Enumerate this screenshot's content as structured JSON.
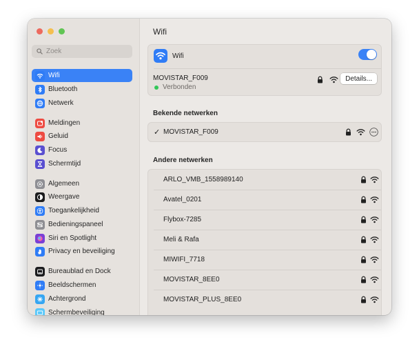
{
  "window": {
    "traffic_lights": [
      "close",
      "minimize",
      "maximize"
    ]
  },
  "sidebar": {
    "search_placeholder": "Zoek",
    "items": [
      {
        "label": "Wifi",
        "icon": "wifi-icon",
        "color": "#2f7cf6",
        "active": true
      },
      {
        "label": "Bluetooth",
        "icon": "bluetooth-icon",
        "color": "#2f7cf6"
      },
      {
        "label": "Netwerk",
        "icon": "globe-icon",
        "color": "#2f7cf6"
      },
      {
        "label": "Meldingen",
        "icon": "notifications-icon",
        "color": "#ee4b42"
      },
      {
        "label": "Geluid",
        "icon": "speaker-icon",
        "color": "#ee4b42"
      },
      {
        "label": "Focus",
        "icon": "moon-icon",
        "color": "#5a4fd0"
      },
      {
        "label": "Schermtijd",
        "icon": "hourglass-icon",
        "color": "#5a4fd0"
      },
      {
        "label": "Algemeen",
        "icon": "gear-icon",
        "color": "#8e8e93"
      },
      {
        "label": "Weergave",
        "icon": "appearance-icon",
        "color": "#1c1c1e"
      },
      {
        "label": "Toegankelijkheid",
        "icon": "accessibility-icon",
        "color": "#2f7cf6"
      },
      {
        "label": "Bedieningspaneel",
        "icon": "control-center-icon",
        "color": "#8e8e93"
      },
      {
        "label": "Siri en Spotlight",
        "icon": "siri-icon",
        "color": "#7a3fd6"
      },
      {
        "label": "Privacy en beveiliging",
        "icon": "hand-icon",
        "color": "#2f7cf6"
      },
      {
        "label": "Bureaublad en Dock",
        "icon": "dock-icon",
        "color": "#1c1c1e"
      },
      {
        "label": "Beeldschermen",
        "icon": "display-icon",
        "color": "#2f7cf6"
      },
      {
        "label": "Achtergrond",
        "icon": "wallpaper-icon",
        "color": "#36a6f2"
      },
      {
        "label": "Schermbeveiliging",
        "icon": "screensaver-icon",
        "color": "#5ac8fa"
      }
    ]
  },
  "main": {
    "title": "Wifi",
    "wifi_toggle": {
      "label": "Wifi",
      "on": true
    },
    "current": {
      "name": "MOVISTAR_F009",
      "status": "Verbonden",
      "status_color": "#34c759",
      "details_label": "Details..."
    },
    "known_header": "Bekende netwerken",
    "known": [
      {
        "name": "MOVISTAR_F009",
        "checked": true
      }
    ],
    "other_header": "Andere netwerken",
    "other": [
      {
        "name": "ARLO_VMB_1558989140"
      },
      {
        "name": "Avatel_0201"
      },
      {
        "name": "Flybox-7285"
      },
      {
        "name": "Meli & Rafa"
      },
      {
        "name": "MIWIFI_7718"
      },
      {
        "name": "MOVISTAR_8EE0"
      },
      {
        "name": "MOVISTAR_PLUS_8EE0"
      }
    ]
  }
}
